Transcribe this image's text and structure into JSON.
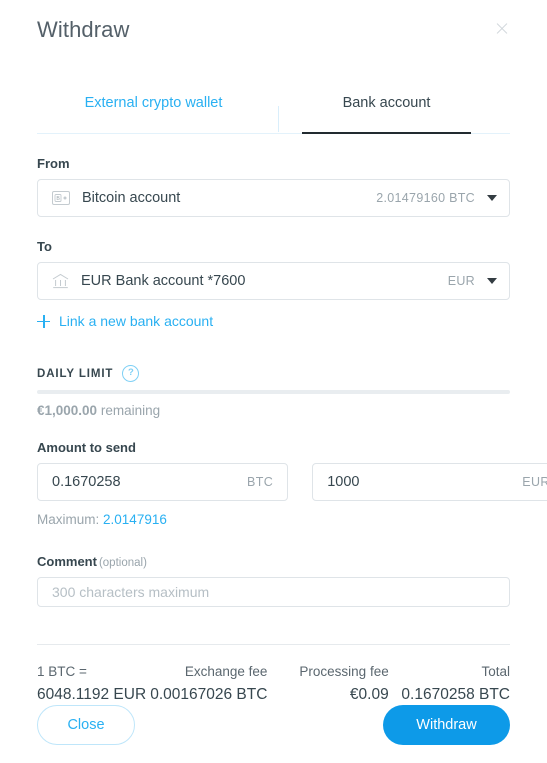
{
  "modal": {
    "title": "Withdraw",
    "close_icon": "close-icon"
  },
  "tabs": [
    {
      "label": "External crypto wallet",
      "active": false
    },
    {
      "label": "Bank account",
      "active": true
    }
  ],
  "from": {
    "label": "From",
    "icon": "wallet-icon",
    "account_name": "Bitcoin account",
    "balance": "2.01479160 BTC",
    "caret_icon": "chevron-down-icon"
  },
  "to": {
    "label": "To",
    "icon": "bank-icon",
    "account_name": "EUR Bank account *7600",
    "currency": "EUR",
    "caret_icon": "chevron-down-icon",
    "link_new_label": "Link a new bank account",
    "link_new_icon": "plus-icon"
  },
  "daily_limit": {
    "title": "DAILY LIMIT",
    "help_icon": "help-circle-icon",
    "help_glyph": "?",
    "progress_percent": 0,
    "amount": "€1,000.00",
    "suffix": "remaining"
  },
  "amount": {
    "label": "Amount to send",
    "crypto_value": "0.1670258",
    "crypto_currency": "BTC",
    "fiat_value": "1000",
    "fiat_currency": "EUR",
    "maximum_label": "Maximum:",
    "maximum_value": "2.0147916"
  },
  "comment": {
    "label": "Comment",
    "optional": "(optional)",
    "value": "",
    "placeholder": "300 characters maximum"
  },
  "summary": [
    {
      "key": "1 BTC =",
      "value": "6048.1192 EUR"
    },
    {
      "key": "Exchange fee",
      "value": "0.00167026 BTC"
    },
    {
      "key": "Processing fee",
      "value": "€0.09"
    },
    {
      "key": "Total",
      "value": "0.1670258 BTC"
    }
  ],
  "footer": {
    "close_label": "Close",
    "withdraw_label": "Withdraw"
  },
  "colors": {
    "accent": "#29b0f2",
    "primary_button": "#0d9ae8",
    "text": "#37474f",
    "muted": "#9aa5ac",
    "border": "#dfe4e8"
  }
}
